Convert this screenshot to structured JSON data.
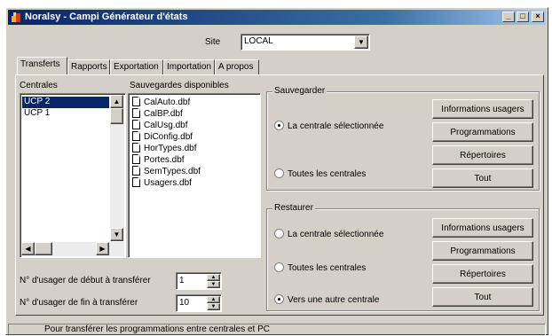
{
  "window": {
    "title": "Noralsy - Campi Générateur d'états",
    "minimize_glyph": "_",
    "maximize_glyph": "□",
    "close_glyph": "×"
  },
  "site": {
    "label": "Site",
    "value": "LOCAL"
  },
  "tabs": [
    {
      "label": "Transferts",
      "active": true
    },
    {
      "label": "Rapports"
    },
    {
      "label": "Exportation"
    },
    {
      "label": "Importation"
    },
    {
      "label": "A propos"
    }
  ],
  "centrales": {
    "label": "Centrales",
    "items": [
      "UCP 2",
      "UCP 1"
    ],
    "selected": "UCP 2"
  },
  "sauvegardes": {
    "label": "Sauvegardes disponibles",
    "items": [
      "CalAuto.dbf",
      "CalBP.dbf",
      "CalUsg.dbf",
      "DiConfig.dbf",
      "HorTypes.dbf",
      "Portes.dbf",
      "SemTypes.dbf",
      "Usagers.dbf"
    ]
  },
  "sauvegarder": {
    "title": "Sauvegarder",
    "radio_selected_label": "La centrale sélectionnée",
    "radio_all_label": "Toutes les centrales",
    "btn_informations": "Informations usagers",
    "btn_programmations": "Programmations",
    "btn_repertoires": "Répertoires",
    "btn_tout": "Tout"
  },
  "restaurer": {
    "title": "Restaurer",
    "radio_selected_label": "La centrale sélectionnée",
    "radio_all_label": "Toutes les centrales",
    "radio_other_label": "Vers une autre centrale",
    "btn_informations": "Informations usagers",
    "btn_programmations": "Programmations",
    "btn_repertoires": "Répertoires",
    "btn_tout": "Tout"
  },
  "transfer": {
    "start_label": "N° d'usager de début à transférer",
    "start_value": "1",
    "end_label": "N° d'usager de fin à transférer",
    "end_value": "10"
  },
  "status_bar": {
    "text": "Pour transférer les programmations entre centrales et PC"
  },
  "colors": {
    "selection": "#0a246a",
    "face": "#d4d0c8",
    "titlebar": "#0a246a"
  }
}
